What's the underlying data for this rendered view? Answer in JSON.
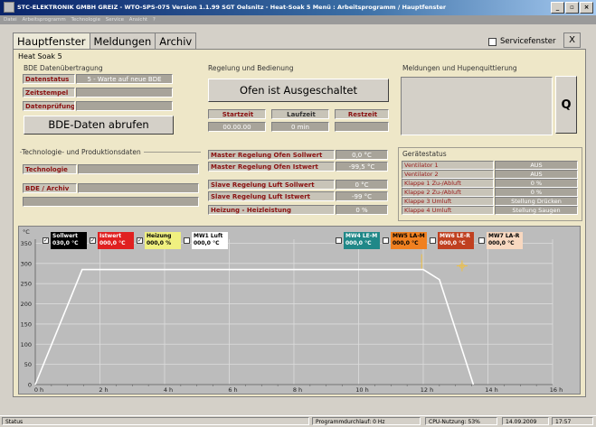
{
  "window": {
    "title": "STC-ELEKTRONIK GMBH GREIZ  -  WTO-SPS-075 Version 1.1.99      SGT Oelsnitz - Heat-Soak 5   Menü : Arbeitsprogramm / Hauptfenster",
    "min": "_",
    "max": "▫",
    "close": "×"
  },
  "menu": [
    "Datei",
    "Arbeitsprogramm",
    "Technologie",
    "Service",
    "Ansicht",
    "?"
  ],
  "tabs": [
    "Hauptfenster",
    "Meldungen",
    "Archiv"
  ],
  "service_label": "Servicefenster",
  "close_label": "X",
  "panel_title": "Heat Soak 5",
  "bde": {
    "title": "BDE Datenübertragung",
    "status_label": "Datenstatus",
    "status_value": "5 - Warte auf neue BDE",
    "stempel_label": "Zeitstempel",
    "pruefung_label": "Datenprüfung",
    "button": "BDE-Daten abrufen"
  },
  "tech": {
    "title": "Technologie- und Produktionsdaten",
    "technologie_label": "Technologie",
    "archiv_label": "BDE / Archiv"
  },
  "regelung": {
    "title": "Regelung und Bedienung",
    "status_button": "Ofen ist Ausgeschaltet",
    "start_label": "Startzeit",
    "lauf_label": "Laufzeit",
    "rest_label": "Restzeit",
    "start_value": "00.00.00",
    "lauf_value": "0 min",
    "rest_value": "",
    "rows": [
      {
        "label": "Master Regelung Ofen Sollwert",
        "value": "0,0 °C"
      },
      {
        "label": "Master Regelung Ofen Istwert",
        "value": "-99,5 °C"
      },
      {
        "label": "Slave Regelung   Luft Sollwert",
        "value": "0   °C"
      },
      {
        "label": "Slave Regelung   Luft Istwert",
        "value": "-99   °C"
      },
      {
        "label": "Heizung - Heizleistung",
        "value": "0    %"
      }
    ]
  },
  "meldungen": {
    "title": "Meldungen und Hupenquittierung",
    "q_button": "Q"
  },
  "geraete": {
    "title": "Gerätestatus",
    "rows": [
      {
        "label": "Ventilator 1",
        "value": "AUS"
      },
      {
        "label": "Ventilator 2",
        "value": "AUS"
      },
      {
        "label": "Klappe 1  Zu-/Abluft",
        "value": "0 %"
      },
      {
        "label": "Klappe 2  Zu-/Abluft",
        "value": "0 %"
      },
      {
        "label": "Klappe 3  Umluft",
        "value": "Stellung Drücken"
      },
      {
        "label": "Klappe 4  Umluft",
        "value": "Stellung Saugen"
      }
    ]
  },
  "trend_tags": [
    {
      "name": "Sollwert",
      "value": "030,0 °C",
      "bg": "#000000",
      "fg": "#ffffff",
      "checked": true
    },
    {
      "name": "Istwert",
      "value": "000,0 °C",
      "bg": "#e02020",
      "fg": "#ffffff",
      "checked": true
    },
    {
      "name": "Heizung",
      "value": "000,0 %",
      "bg": "#f0f080",
      "fg": "#000000",
      "checked": true
    },
    {
      "name": "MW1 Luft",
      "value": "000,0 °C",
      "bg": "#ffffff",
      "fg": "#000000",
      "checked": false
    },
    {
      "name": "MW4 LE-M",
      "value": "000,0 °C",
      "bg": "#208888",
      "fg": "#ffffff",
      "checked": false
    },
    {
      "name": "MW5 LA-M",
      "value": "000,0 °C",
      "bg": "#f08020",
      "fg": "#000000",
      "checked": false
    },
    {
      "name": "MW6 LE-R",
      "value": "000,0 °C",
      "bg": "#c04020",
      "fg": "#ffffff",
      "checked": false
    },
    {
      "name": "MW7 LA-R",
      "value": "000,0 °C",
      "bg": "#f8d8c0",
      "fg": "#000000",
      "checked": false
    }
  ],
  "chart_data": {
    "type": "line",
    "ylabel": "°C",
    "ylim": [
      0,
      360
    ],
    "xlim": [
      0,
      16
    ],
    "y_ticks": [
      "350",
      "300",
      "250",
      "200",
      "150",
      "100",
      "50",
      "0"
    ],
    "x_ticks": [
      "0 h",
      "2 h",
      "4 h",
      "6 h",
      "8 h",
      "10 h",
      "12 h",
      "14 h",
      "16 h"
    ],
    "series": [
      {
        "name": "Sollwert",
        "color": "#ffffff",
        "x": [
          0,
          1.45,
          12.0,
          12.5,
          13.55
        ],
        "y": [
          0,
          285,
          285,
          260,
          0
        ]
      }
    ],
    "markers": [
      {
        "x": 11.95,
        "y": 305,
        "color": "#f0c040"
      },
      {
        "x": 13.2,
        "y": 294,
        "color": "#f0c040"
      }
    ]
  },
  "status": {
    "text": "Status",
    "program": "Programmdurchlauf: 0 Hz",
    "cpu": "CPU-Nutzung: 53%",
    "date": "14.09.2009",
    "time": "17:57"
  }
}
